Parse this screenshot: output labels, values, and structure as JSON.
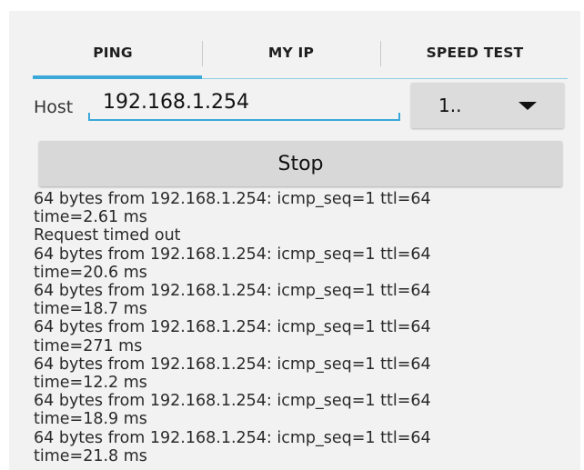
{
  "tabs": [
    {
      "label": "PING",
      "selected": true
    },
    {
      "label": "MY IP",
      "selected": false
    },
    {
      "label": "SPEED TEST",
      "selected": false
    }
  ],
  "host": {
    "label": "Host",
    "value": "192.168.1.254"
  },
  "count_select": {
    "value": "1..",
    "icon": "triangle-down-icon"
  },
  "stop_button": {
    "label": "Stop"
  },
  "log": {
    "lines": [
      "64 bytes from 192.168.1.254: icmp_seq=1 ttl=64",
      "time=2.61 ms",
      "Request timed out",
      "64 bytes from 192.168.1.254: icmp_seq=1 ttl=64",
      "time=20.6 ms",
      "64 bytes from 192.168.1.254: icmp_seq=1 ttl=64",
      "time=18.7 ms",
      "64 bytes from 192.168.1.254: icmp_seq=1 ttl=64",
      "time=271 ms",
      "64 bytes from 192.168.1.254: icmp_seq=1 ttl=64",
      "time=12.2 ms",
      "64 bytes from 192.168.1.254: icmp_seq=1 ttl=64",
      "time=18.9 ms",
      "64 bytes from 192.168.1.254: icmp_seq=1 ttl=64",
      "time=21.8 ms"
    ]
  },
  "colors": {
    "accent": "#3aa8d8",
    "background": "#f2f2f2",
    "button": "#d8d8d8"
  }
}
